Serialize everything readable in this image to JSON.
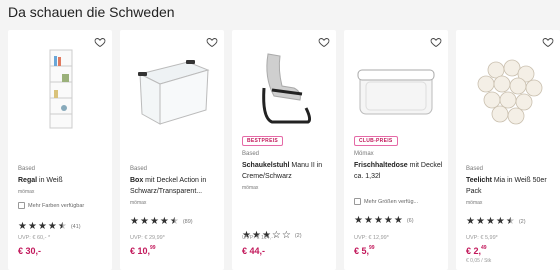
{
  "heading": "Da schauen die Schweden",
  "colors": {
    "accent": "#c2185b",
    "star": "#333333",
    "background": "#f4f4f4"
  },
  "products": [
    {
      "badge": "",
      "brand": "Based",
      "title_bold": "Regal",
      "title_rest": " in Weiß",
      "shop": "mömax",
      "note": "Mehr Farben verfügbar",
      "rating": 4.5,
      "reviews": "(41)",
      "uvp": "UVP: € 60,- *",
      "price_main": "€ 30,-",
      "price_sup": "",
      "unit_price": ""
    },
    {
      "badge": "",
      "brand": "Based",
      "title_bold": "Box",
      "title_rest": " mit Deckel Action in Schwarz/Transparent...",
      "shop": "mömax",
      "note": "",
      "rating": 4.5,
      "reviews": "(89)",
      "uvp": "UVP: € 29,99*",
      "price_main": "€ 10,",
      "price_sup": "99",
      "unit_price": ""
    },
    {
      "badge": "BESTPREIS",
      "brand": "Based",
      "title_bold": "Schaukelstuhl",
      "title_rest": " Manu II in Creme/Schwarz",
      "shop": "mömax",
      "note": "",
      "rating": 3,
      "reviews": "(2)",
      "uvp": "UVP: € 114,- *",
      "price_main": "€ 44,-",
      "price_sup": "",
      "unit_price": ""
    },
    {
      "badge": "CLUB-PREIS",
      "brand": "Mömax",
      "title_bold": "Frischhaltedose",
      "title_rest": " mit Deckel ca. 1,32l",
      "shop": "mömax",
      "note": "Mehr Größen verfüg...",
      "rating": 5,
      "reviews": "(6)",
      "uvp": "UVP: € 12,99*",
      "price_main": "€ 5,",
      "price_sup": "99",
      "unit_price": ""
    },
    {
      "badge": "",
      "brand": "Based",
      "title_bold": "Teelicht",
      "title_rest": " Mia in Weiß 50er Pack",
      "shop": "mömax",
      "note": "",
      "rating": 4.5,
      "reviews": "(2)",
      "uvp": "UVP: € 5,99*",
      "price_main": "€ 2,",
      "price_sup": "49",
      "unit_price": "€ 0,05 / Stk"
    }
  ]
}
